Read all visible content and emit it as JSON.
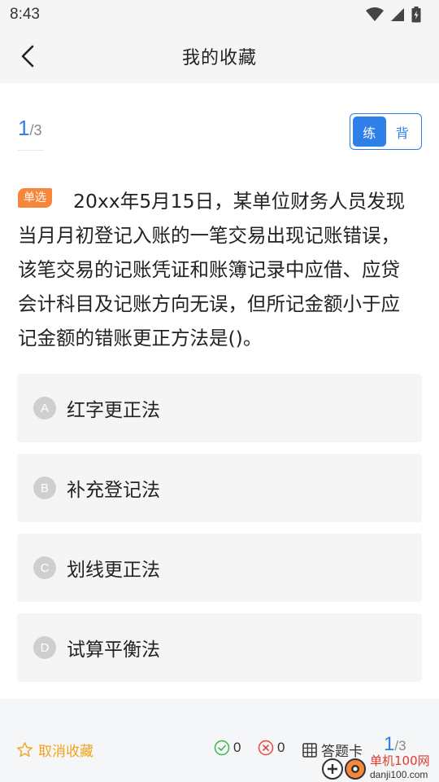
{
  "status_bar": {
    "time": "8:43",
    "icons": [
      "wifi-icon",
      "signal-icon",
      "battery-icon"
    ]
  },
  "header": {
    "title": "我的收藏",
    "back_icon": "chevron-left-icon"
  },
  "progress": {
    "current": "1",
    "total": "/3"
  },
  "mode_toggle": {
    "practice": "练",
    "memorize": "背",
    "active": "practice"
  },
  "question": {
    "type_tag": "单选",
    "text": "20xx年5月15日，某单位财务人员发现当月月初登记入账的一笔交易出现记账错误，该笔交易的记账凭证和账簿记录中应借、应贷会计科目及记账方向无误，但所记金额小于应记金额的错账更正方法是()。"
  },
  "options": [
    {
      "letter": "A",
      "text": "红字更正法"
    },
    {
      "letter": "B",
      "text": "补充登记法"
    },
    {
      "letter": "C",
      "text": "划线更正法"
    },
    {
      "letter": "D",
      "text": "试算平衡法"
    }
  ],
  "bottom_bar": {
    "unfavorite_label": "取消收藏",
    "correct_count": "0",
    "wrong_count": "0",
    "answer_card_label": "答题卡",
    "progress_current": "1",
    "progress_total": "/3"
  },
  "watermark": {
    "text": "单机100网",
    "url": "danji100.com"
  },
  "colors": {
    "accent": "#2f7fe8",
    "tag": "#f7873a",
    "favorite": "#f2a31c",
    "correct": "#3bb54a",
    "wrong": "#e5483e"
  }
}
